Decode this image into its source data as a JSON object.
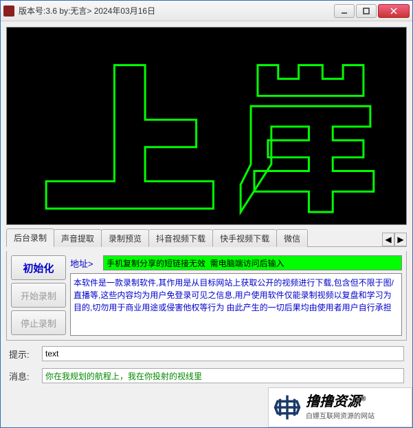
{
  "title": "版本号:3.6 by:无言> 2024年03月16日",
  "banner_text": "上岸",
  "tabs": [
    "后台录制",
    "声音提取",
    "录制预览",
    "抖音视频下载",
    "快手视频下载",
    "微信"
  ],
  "active_tab": 0,
  "buttons": {
    "init": "初始化",
    "start": "开始录制",
    "stop": "停止录制"
  },
  "address": {
    "label": "地址>",
    "value": "手机复制分享的短链接无效  需电脑端访问后输入"
  },
  "disclaimer": "本软件是一款录制软件,其作用是从目标网站上获取公开的视频进行下载,包含但不限于图/直播等,这些内容均为用户免登录可见之信息,用户使用软件仅能录制视频以复盘和学习为目的,切勿用于商业用途或侵害他权等行为   由此产生的一切后果均由使用者用户自行承担",
  "prompt": {
    "label": "提示:",
    "value": "text"
  },
  "message": {
    "label": "消息:",
    "value": "你在我规划的航程上，我在你投射的视线里"
  },
  "watermark": {
    "brand": "撸撸资源",
    "reg": "®",
    "tagline": "白嫖互联网资源的网站"
  }
}
